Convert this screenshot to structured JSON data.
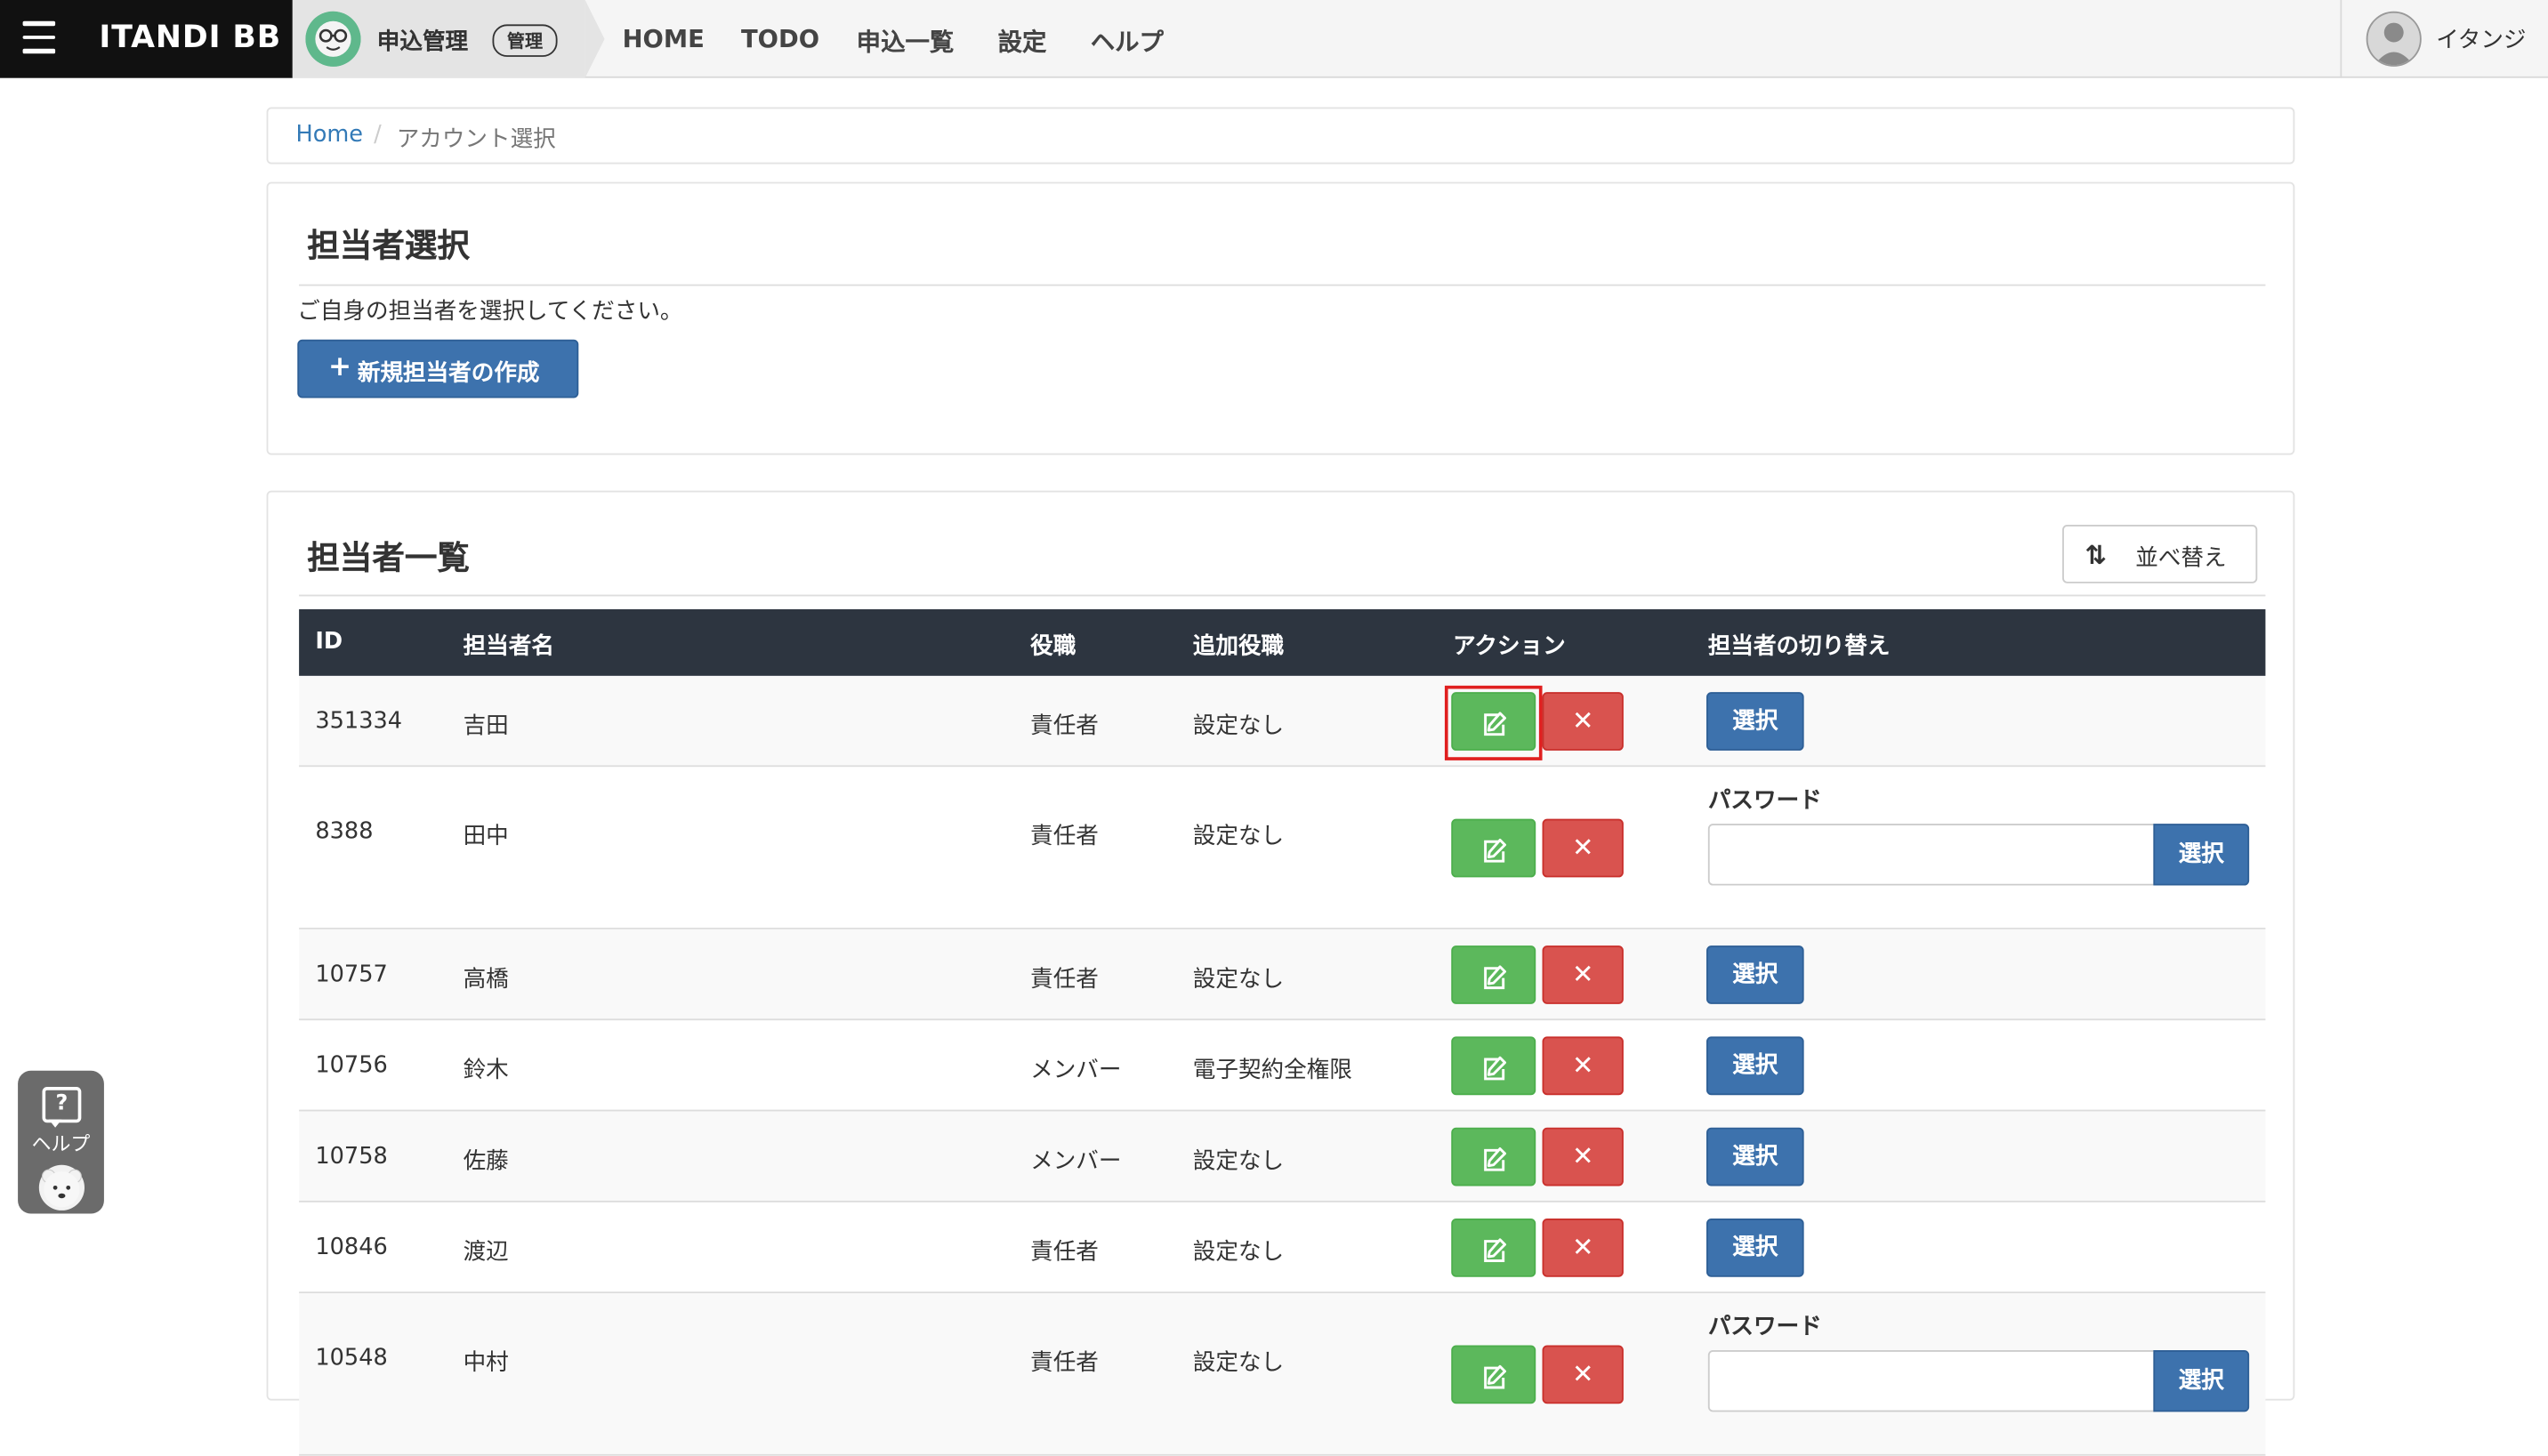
{
  "header": {
    "brand": "ITANDI BB",
    "app_name": "申込管理",
    "app_badge": "管理",
    "nav": [
      "HOME",
      "TODO",
      "申込一覧",
      "設定",
      "ヘルプ"
    ],
    "user_name": "イタンジ"
  },
  "breadcrumb": {
    "home": "Home",
    "separator": "/",
    "current": "アカウント選択"
  },
  "select_panel": {
    "title": "担当者選択",
    "description": "ご自身の担当者を選択してください。",
    "new_button_icon": "+",
    "new_button_label": "新規担当者の作成"
  },
  "list_panel": {
    "title": "担当者一覧",
    "sort_icon": "⇅",
    "sort_label": "並べ替え",
    "columns": [
      "ID",
      "担当者名",
      "役職",
      "追加役職",
      "アクション",
      "担当者の切り替え"
    ],
    "delete_glyph": "✕",
    "select_label": "選択",
    "password_label": "パスワード",
    "rows": [
      {
        "id": "351334",
        "name": "吉田",
        "role": "責任者",
        "extra": "設定なし"
      },
      {
        "id": "8388",
        "name": "田中",
        "role": "責任者",
        "extra": "設定なし"
      },
      {
        "id": "10757",
        "name": "高橋",
        "role": "責任者",
        "extra": "設定なし"
      },
      {
        "id": "10756",
        "name": "鈴木",
        "role": "メンバー",
        "extra": "電子契約全権限"
      },
      {
        "id": "10758",
        "name": "佐藤",
        "role": "メンバー",
        "extra": "設定なし"
      },
      {
        "id": "10846",
        "name": "渡辺",
        "role": "責任者",
        "extra": "設定なし"
      },
      {
        "id": "10548",
        "name": "中村",
        "role": "責任者",
        "extra": "設定なし"
      }
    ]
  },
  "help_widget": {
    "icon": "?",
    "label": "ヘルプ"
  },
  "colors": {
    "primary": "#3d72ad",
    "success": "#5cb85c",
    "danger": "#d9534f",
    "header_dark": "#2d3540",
    "highlight": "#e02020"
  }
}
